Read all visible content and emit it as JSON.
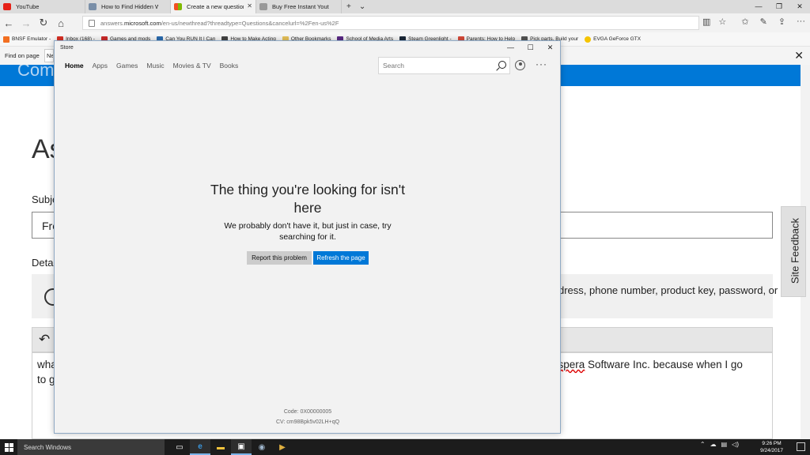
{
  "browser": {
    "tabs": [
      {
        "label": "YouTube",
        "color": "#e62117",
        "active": false
      },
      {
        "label": "How to Find Hidden Windo",
        "color": "#7a8fa8",
        "active": false
      },
      {
        "label": "Create a new question o",
        "color": "#f25022",
        "active": true
      },
      {
        "label": "Buy Free Instant Youtube Di",
        "color": "#999999",
        "active": false
      }
    ],
    "new_tab": "+",
    "tab_menu": "⌄",
    "url_prefix": "answers.",
    "url_domain": "microsoft.com",
    "url_rest": "/en-us/newthread?threadtype=Questions&cancelurl=%2Fen-us%2F",
    "favorites": [
      {
        "label": "BNSF Emulator -",
        "color": "#f26f21"
      },
      {
        "label": "Inbox (168) -",
        "color": "#d93025"
      },
      {
        "label": "Games and mods",
        "color": "#cc2a2a"
      },
      {
        "label": "Can You RUN It | Can",
        "color": "#2b6cb0"
      },
      {
        "label": "How to Make Acting",
        "color": "#444444"
      },
      {
        "label": "Other Bookmarks",
        "color": "#e8c35a"
      },
      {
        "label": "School of Media Arts",
        "color": "#5b2a86"
      },
      {
        "label": "Steam Greenlight -",
        "color": "#1b2838"
      },
      {
        "label": "Parents: How to Help",
        "color": "#d84a3a"
      },
      {
        "label": "Pick parts. Build your",
        "color": "#555555"
      },
      {
        "label": "EVGA GeForce GTX",
        "color": "#f5c400"
      }
    ],
    "find_label": "Find on page",
    "find_value": "Ne"
  },
  "page": {
    "banner_text": "Com",
    "heading": "As",
    "subject_label": "Subje",
    "subject_value": "Fre",
    "details_label": "Deta",
    "notice_text": "dress, phone number, product key, password, or",
    "body_line1_start": "wha",
    "body_line1_end_pre": "",
    "body_squiggle": "ospera",
    "body_line1_end": " Software Inc. because when I go",
    "body_line2_start": "to g",
    "site_feedback": "Site Feedback"
  },
  "store": {
    "window_title": "Store",
    "nav": [
      "Home",
      "Apps",
      "Games",
      "Music",
      "Movies & TV",
      "Books"
    ],
    "search_placeholder": "Search",
    "error_title": "The thing you're looking for isn't here",
    "error_subtitle": "We probably don't have it, but just in case, try searching for it.",
    "report_button": "Report this problem",
    "refresh_button": "Refresh the page",
    "code": "Code: 0X00000005",
    "cv": "CV: cm98Bpk5v02LH+qQ"
  },
  "taskbar": {
    "search_placeholder": "Search Windows",
    "time": "9:26 PM",
    "date": "9/24/2017"
  }
}
